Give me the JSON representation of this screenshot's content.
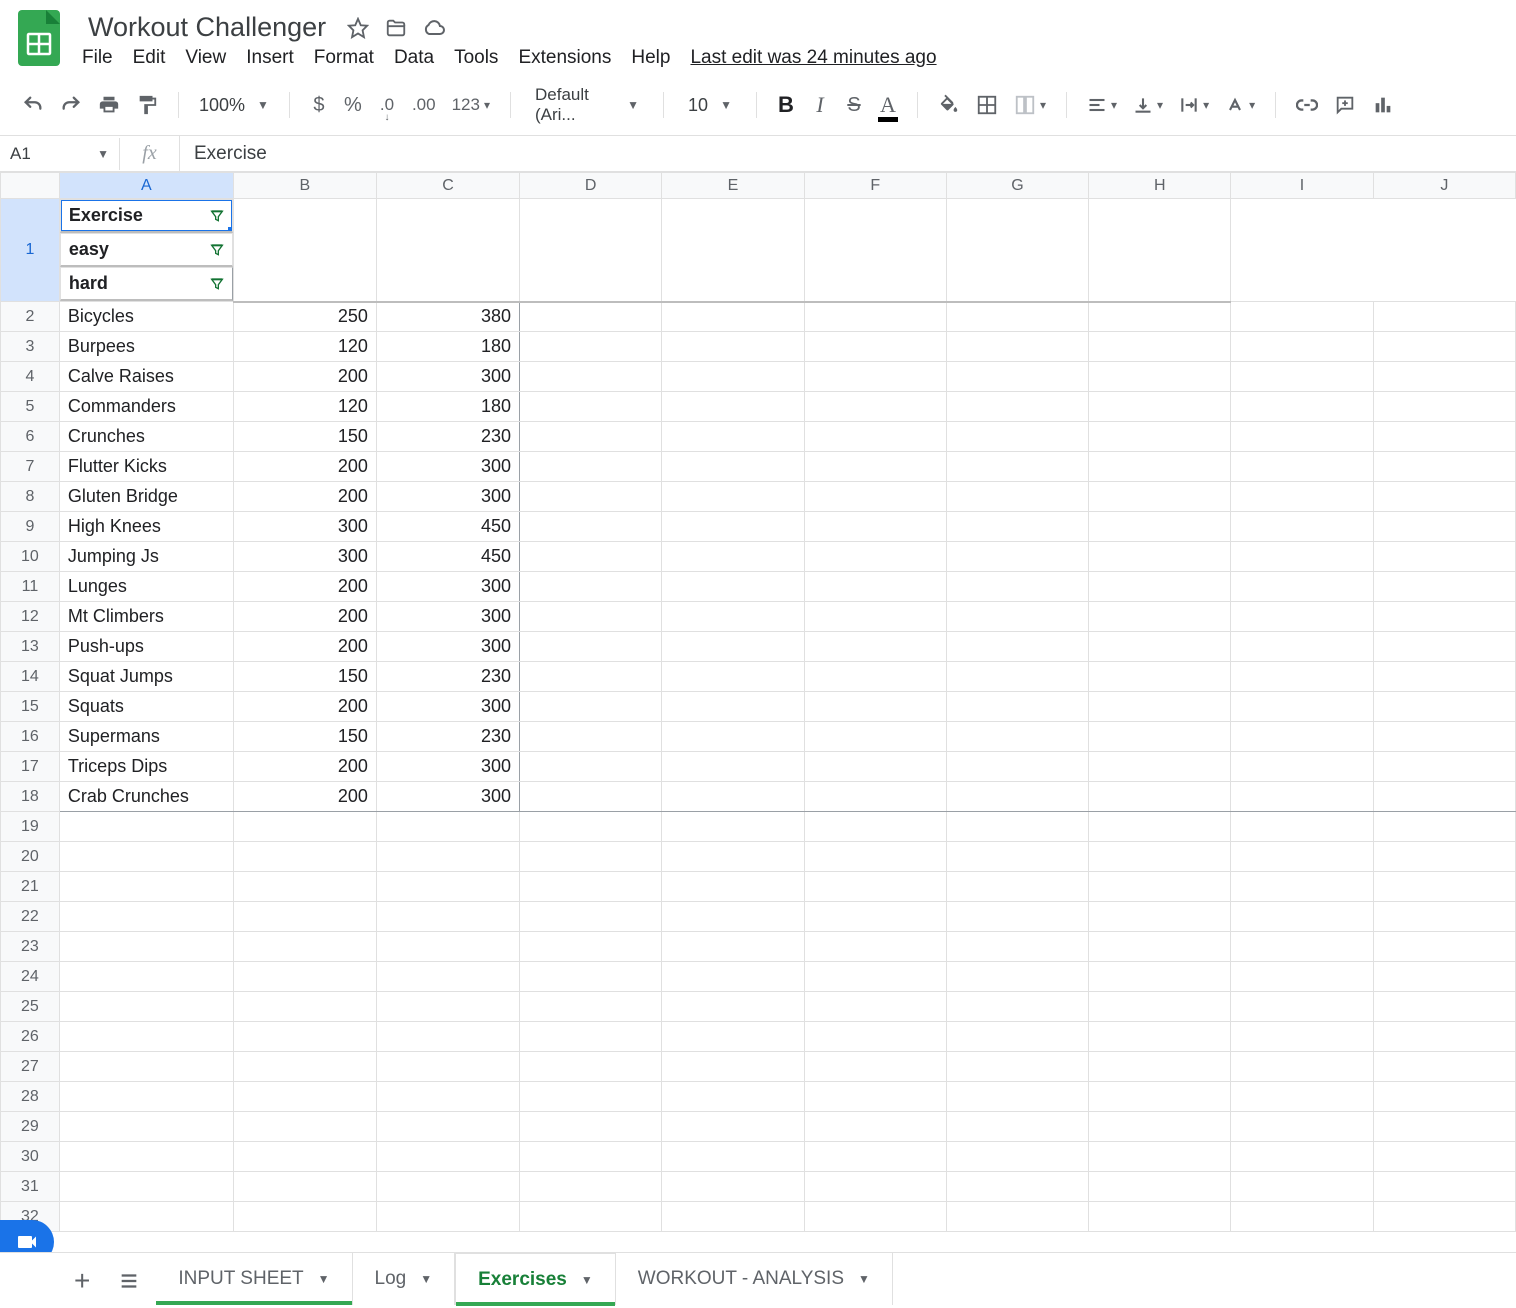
{
  "doc": {
    "title": "Workout Challenger",
    "last_edit": "Last edit was 24 minutes ago"
  },
  "menu": {
    "file": "File",
    "edit": "Edit",
    "view": "View",
    "insert": "Insert",
    "format": "Format",
    "data": "Data",
    "tools": "Tools",
    "extensions": "Extensions",
    "help": "Help"
  },
  "toolbar": {
    "zoom": "100%",
    "font_name": "Default (Ari...",
    "font_size": "10",
    "currency": "$",
    "percent": "%",
    "dec_dec": ".0",
    "inc_dec": ".00",
    "more_formats": "123",
    "bold": "B",
    "italic": "I",
    "strike": "S",
    "text_color": "A"
  },
  "namebox": {
    "ref": "A1"
  },
  "formula_bar": {
    "value": "Exercise"
  },
  "columns": [
    "A",
    "B",
    "C",
    "D",
    "E",
    "F",
    "G",
    "H",
    "I",
    "J"
  ],
  "selected_col": "A",
  "selected_row": 1,
  "headers": {
    "a": "Exercise",
    "b": "easy",
    "c": "hard"
  },
  "rows": [
    {
      "n": 2,
      "name": "Bicycles",
      "easy": 250,
      "hard": 380
    },
    {
      "n": 3,
      "name": "Burpees",
      "easy": 120,
      "hard": 180
    },
    {
      "n": 4,
      "name": "Calve Raises",
      "easy": 200,
      "hard": 300
    },
    {
      "n": 5,
      "name": "Commanders",
      "easy": 120,
      "hard": 180
    },
    {
      "n": 6,
      "name": "Crunches",
      "easy": 150,
      "hard": 230
    },
    {
      "n": 7,
      "name": "Flutter Kicks",
      "easy": 200,
      "hard": 300
    },
    {
      "n": 8,
      "name": "Gluten Bridge",
      "easy": 200,
      "hard": 300
    },
    {
      "n": 9,
      "name": "High Knees",
      "easy": 300,
      "hard": 450
    },
    {
      "n": 10,
      "name": "Jumping Js",
      "easy": 300,
      "hard": 450
    },
    {
      "n": 11,
      "name": "Lunges",
      "easy": 200,
      "hard": 300
    },
    {
      "n": 12,
      "name": "Mt Climbers",
      "easy": 200,
      "hard": 300
    },
    {
      "n": 13,
      "name": "Push-ups",
      "easy": 200,
      "hard": 300
    },
    {
      "n": 14,
      "name": "Squat Jumps",
      "easy": 150,
      "hard": 230
    },
    {
      "n": 15,
      "name": "Squats",
      "easy": 200,
      "hard": 300
    },
    {
      "n": 16,
      "name": "Supermans",
      "easy": 150,
      "hard": 230
    },
    {
      "n": 17,
      "name": "Triceps Dips",
      "easy": 200,
      "hard": 300
    },
    {
      "n": 18,
      "name": "Crab Crunches",
      "easy": 200,
      "hard": 300
    }
  ],
  "empty_rows_from": 19,
  "empty_rows_to": 32,
  "tabs": [
    {
      "label": "INPUT SHEET",
      "active": false,
      "underline": true
    },
    {
      "label": "Log",
      "active": false,
      "underline": false
    },
    {
      "label": "Exercises",
      "active": true,
      "underline": false
    },
    {
      "label": "WORKOUT - ANALYSIS",
      "active": false,
      "underline": false
    }
  ]
}
